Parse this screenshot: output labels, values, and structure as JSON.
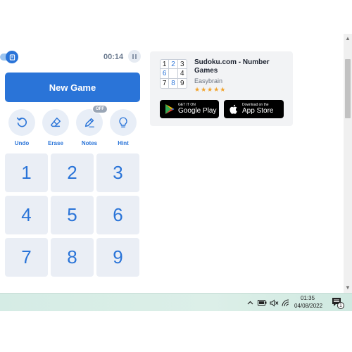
{
  "toolbar": {
    "mode_toggle_icon": "notebook-icon",
    "timer": "00:14",
    "pause_icon": "pause-icon"
  },
  "actions": {
    "new_game_label": "New Game"
  },
  "tools": {
    "undo_label": "Undo",
    "erase_label": "Erase",
    "notes_label": "Notes",
    "notes_badge": "OFF",
    "hint_label": "Hint"
  },
  "numpad": [
    "1",
    "2",
    "3",
    "4",
    "5",
    "6",
    "7",
    "8",
    "9"
  ],
  "promo": {
    "logo_digits": [
      "1",
      "2",
      "3",
      "6",
      "",
      "4",
      "7",
      "8",
      "9"
    ],
    "title": "Sudoku.com - Number Games",
    "developer": "Easybrain",
    "stars": "★★★★★",
    "rating": 4.5,
    "google_play_small": "GET IT ON",
    "google_play_big": "Google Play",
    "app_store_small": "Download on the",
    "app_store_big": "App Store"
  },
  "taskbar": {
    "time": "01:35",
    "date": "04/08/2022",
    "notification_count": "1",
    "tray_icons": [
      "chevron-up-icon",
      "battery-icon",
      "speaker-muted-icon",
      "wifi-icon"
    ]
  },
  "colors": {
    "accent": "#2a74d8",
    "numpad_bg": "#eaeef5",
    "star": "#f1a32c"
  }
}
